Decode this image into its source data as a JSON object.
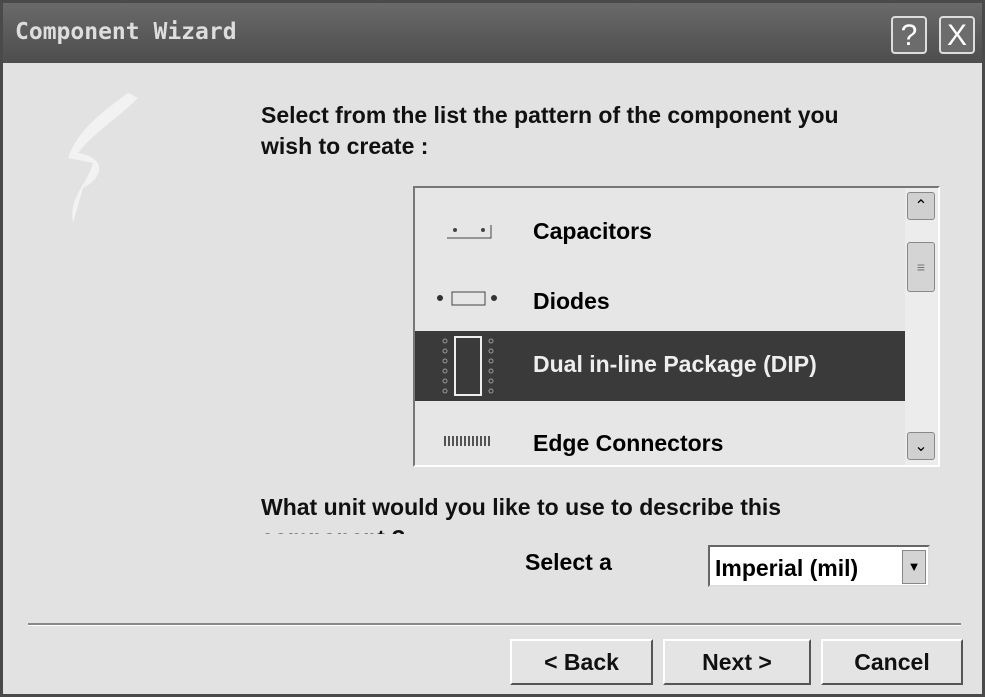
{
  "window": {
    "title": "Component Wizard",
    "help_label": "?",
    "close_label": "X"
  },
  "prompt": {
    "line1": "Select from the list the pattern of the component you",
    "line2": "wish to create :"
  },
  "list": {
    "items": [
      {
        "label": "Capacitors",
        "icon": "capacitor-footprint-icon",
        "selected": false
      },
      {
        "label": "Diodes",
        "icon": "diode-footprint-icon",
        "selected": false
      },
      {
        "label": "Dual in-line Package (DIP)",
        "icon": "dip-footprint-icon",
        "selected": true
      },
      {
        "label": "Edge Connectors",
        "icon": "edge-connector-icon",
        "selected": false
      }
    ]
  },
  "unit": {
    "line1": "What unit would you like to use to describe this",
    "line2": "component ?",
    "select_label": "Select a",
    "selected_value": "Imperial (mil)"
  },
  "buttons": {
    "back": "< Back",
    "next": "Next >",
    "cancel": "Cancel"
  },
  "colors": {
    "selection": "#3a3a3a",
    "titlebar": "#5a5a5a",
    "background": "#e2e2e2"
  }
}
